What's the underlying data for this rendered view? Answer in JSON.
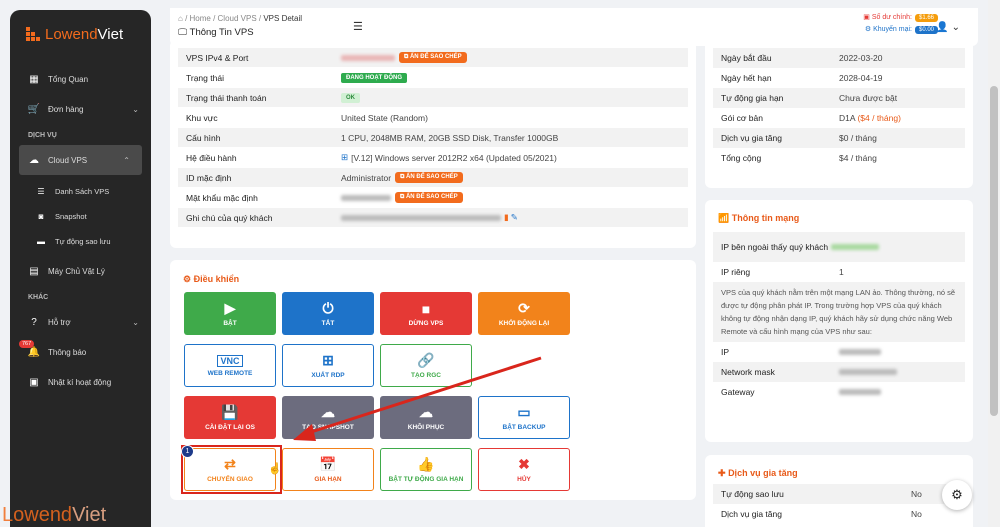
{
  "sidebar": {
    "logo_text_a": "Lowend",
    "logo_text_b": "Viet",
    "items": [
      {
        "label": "Tổng Quan"
      },
      {
        "label": "Đơn hàng"
      }
    ],
    "section_service": "DỊCH VỤ",
    "cloud_vps": "Cloud VPS",
    "sub_items": [
      {
        "label": "Danh Sách VPS"
      },
      {
        "label": "Snapshot"
      },
      {
        "label": "Tự động sao lưu"
      }
    ],
    "physical": "Máy Chủ Vật Lý",
    "section_other": "KHÁC",
    "support": "Hỗ trợ",
    "notifications": "Thông báo",
    "notif_badge": "767",
    "activity_log": "Nhật kí hoạt động"
  },
  "topbar": {
    "breadcrumb_home": "Home",
    "breadcrumb_cloud": "Cloud VPS",
    "breadcrumb_current": "VPS Detail",
    "page_title": "Thông Tin VPS",
    "main_balance_label": "Số dư chính:",
    "main_balance_value": "$1.66",
    "promo_label": "Khuyến mại:",
    "promo_value": "$0.00"
  },
  "vps_info": {
    "rows": [
      {
        "label": "VPS IPv4 & Port"
      },
      {
        "label": "Trạng thái",
        "value": "ĐANG HOẠT ĐỘNG"
      },
      {
        "label": "Trạng thái thanh toán",
        "value": "OK"
      },
      {
        "label": "Khu vực",
        "value": "United State (Random)"
      },
      {
        "label": "Cấu hình",
        "value": "1 CPU, 2048MB RAM, 20GB SSD Disk, Transfer 1000GB"
      },
      {
        "label": "Hệ điều hành",
        "value": "[V.12] Windows server 2012R2 x64 (Updated 05/2021)"
      },
      {
        "label": "ID mặc định",
        "value": "Administrator"
      },
      {
        "label": "Mật khẩu mặc định"
      },
      {
        "label": "Ghi chú của quý khách"
      }
    ],
    "copy_label": "ẤN ĐỂ SAO CHÉP"
  },
  "controls": {
    "title": "Điều khiển",
    "buttons": [
      {
        "label": "BẬT"
      },
      {
        "label": "TẮT"
      },
      {
        "label": "DỪNG VPS"
      },
      {
        "label": "KHỞI ĐỘNG LẠI"
      },
      {
        "label": "WEB REMOTE"
      },
      {
        "label": "XUẤT RDP"
      },
      {
        "label": "TẠO RGC"
      },
      {
        "label": "CÀI ĐẶT LẠI OS"
      },
      {
        "label": "TẠO SNAPSHOT"
      },
      {
        "label": "KHÔI PHỤC"
      },
      {
        "label": "BẬT BACKUP"
      },
      {
        "label": "CHUYỂN GIAO"
      },
      {
        "label": "GIA HẠN"
      },
      {
        "label": "BẬT TỰ ĐỘNG GIA HẠN"
      },
      {
        "label": "HỦY"
      }
    ],
    "step_number": "1"
  },
  "billing": {
    "rows": [
      {
        "label": "Ngày bắt đầu",
        "value": "2022-03-20"
      },
      {
        "label": "Ngày hết hạn",
        "value": "2028-04-19"
      },
      {
        "label": "Tự động gia hạn",
        "value": "Chưa được bật"
      },
      {
        "label": "Gói cơ bản",
        "value": "D1A",
        "value2": "($4 / tháng)"
      },
      {
        "label": "Dịch vụ gia tăng",
        "value": "$0 / tháng"
      },
      {
        "label": "Tổng cộng",
        "value": "$4 / tháng"
      }
    ]
  },
  "network": {
    "title": "Thông tin mạng",
    "public_ip_label": "IP bên ngoài thấy quý khách",
    "private_ip_label": "IP riêng",
    "private_ip_value": "1",
    "info": "VPS của quý khách nằm trên một mạng LAN ảo. Thông thường, nó sẽ được tự động phân phát IP. Trong trường hợp VPS của quý khách không tự động nhận dạng IP, quý khách hãy sử dụng chức năng Web Remote và cấu hình mạng của VPS như sau:",
    "ip_label": "IP",
    "mask_label": "Network mask",
    "gateway_label": "Gateway"
  },
  "addons": {
    "title": "Dịch vụ gia tăng",
    "rows": [
      {
        "label": "Tự động sao lưu",
        "value": "No"
      },
      {
        "label": "Dịch vụ gia tăng",
        "value": "No"
      }
    ]
  },
  "watermark_a": "Lowend",
  "watermark_b": "Viet"
}
